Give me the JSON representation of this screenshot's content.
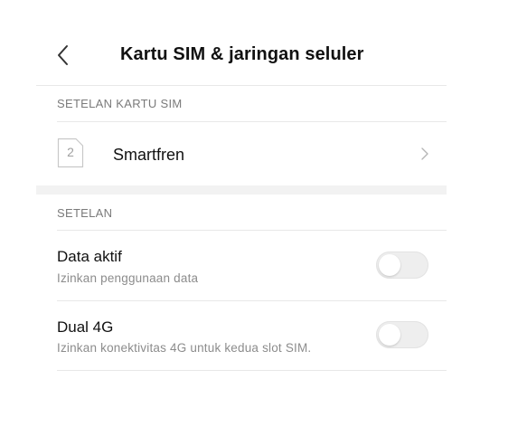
{
  "header": {
    "title": "Kartu SIM & jaringan seluler",
    "back_icon": "chevron-left-icon"
  },
  "sim_section": {
    "label": "SETELAN KARTU SIM",
    "sim": {
      "slot_number": "2",
      "name": "Smartfren",
      "icon": "sim-card-icon"
    }
  },
  "settings_section": {
    "label": "SETELAN",
    "items": [
      {
        "title": "Data aktif",
        "subtitle": "Izinkan penggunaan data",
        "enabled": false
      },
      {
        "title": "Dual 4G",
        "subtitle": "Izinkan konektivitas 4G untuk kedua slot SIM.",
        "enabled": false
      }
    ]
  },
  "colors": {
    "toggle_off_track": "#eeeeee",
    "divider": "#e8e8e8",
    "section_label": "#7a7a7a"
  }
}
